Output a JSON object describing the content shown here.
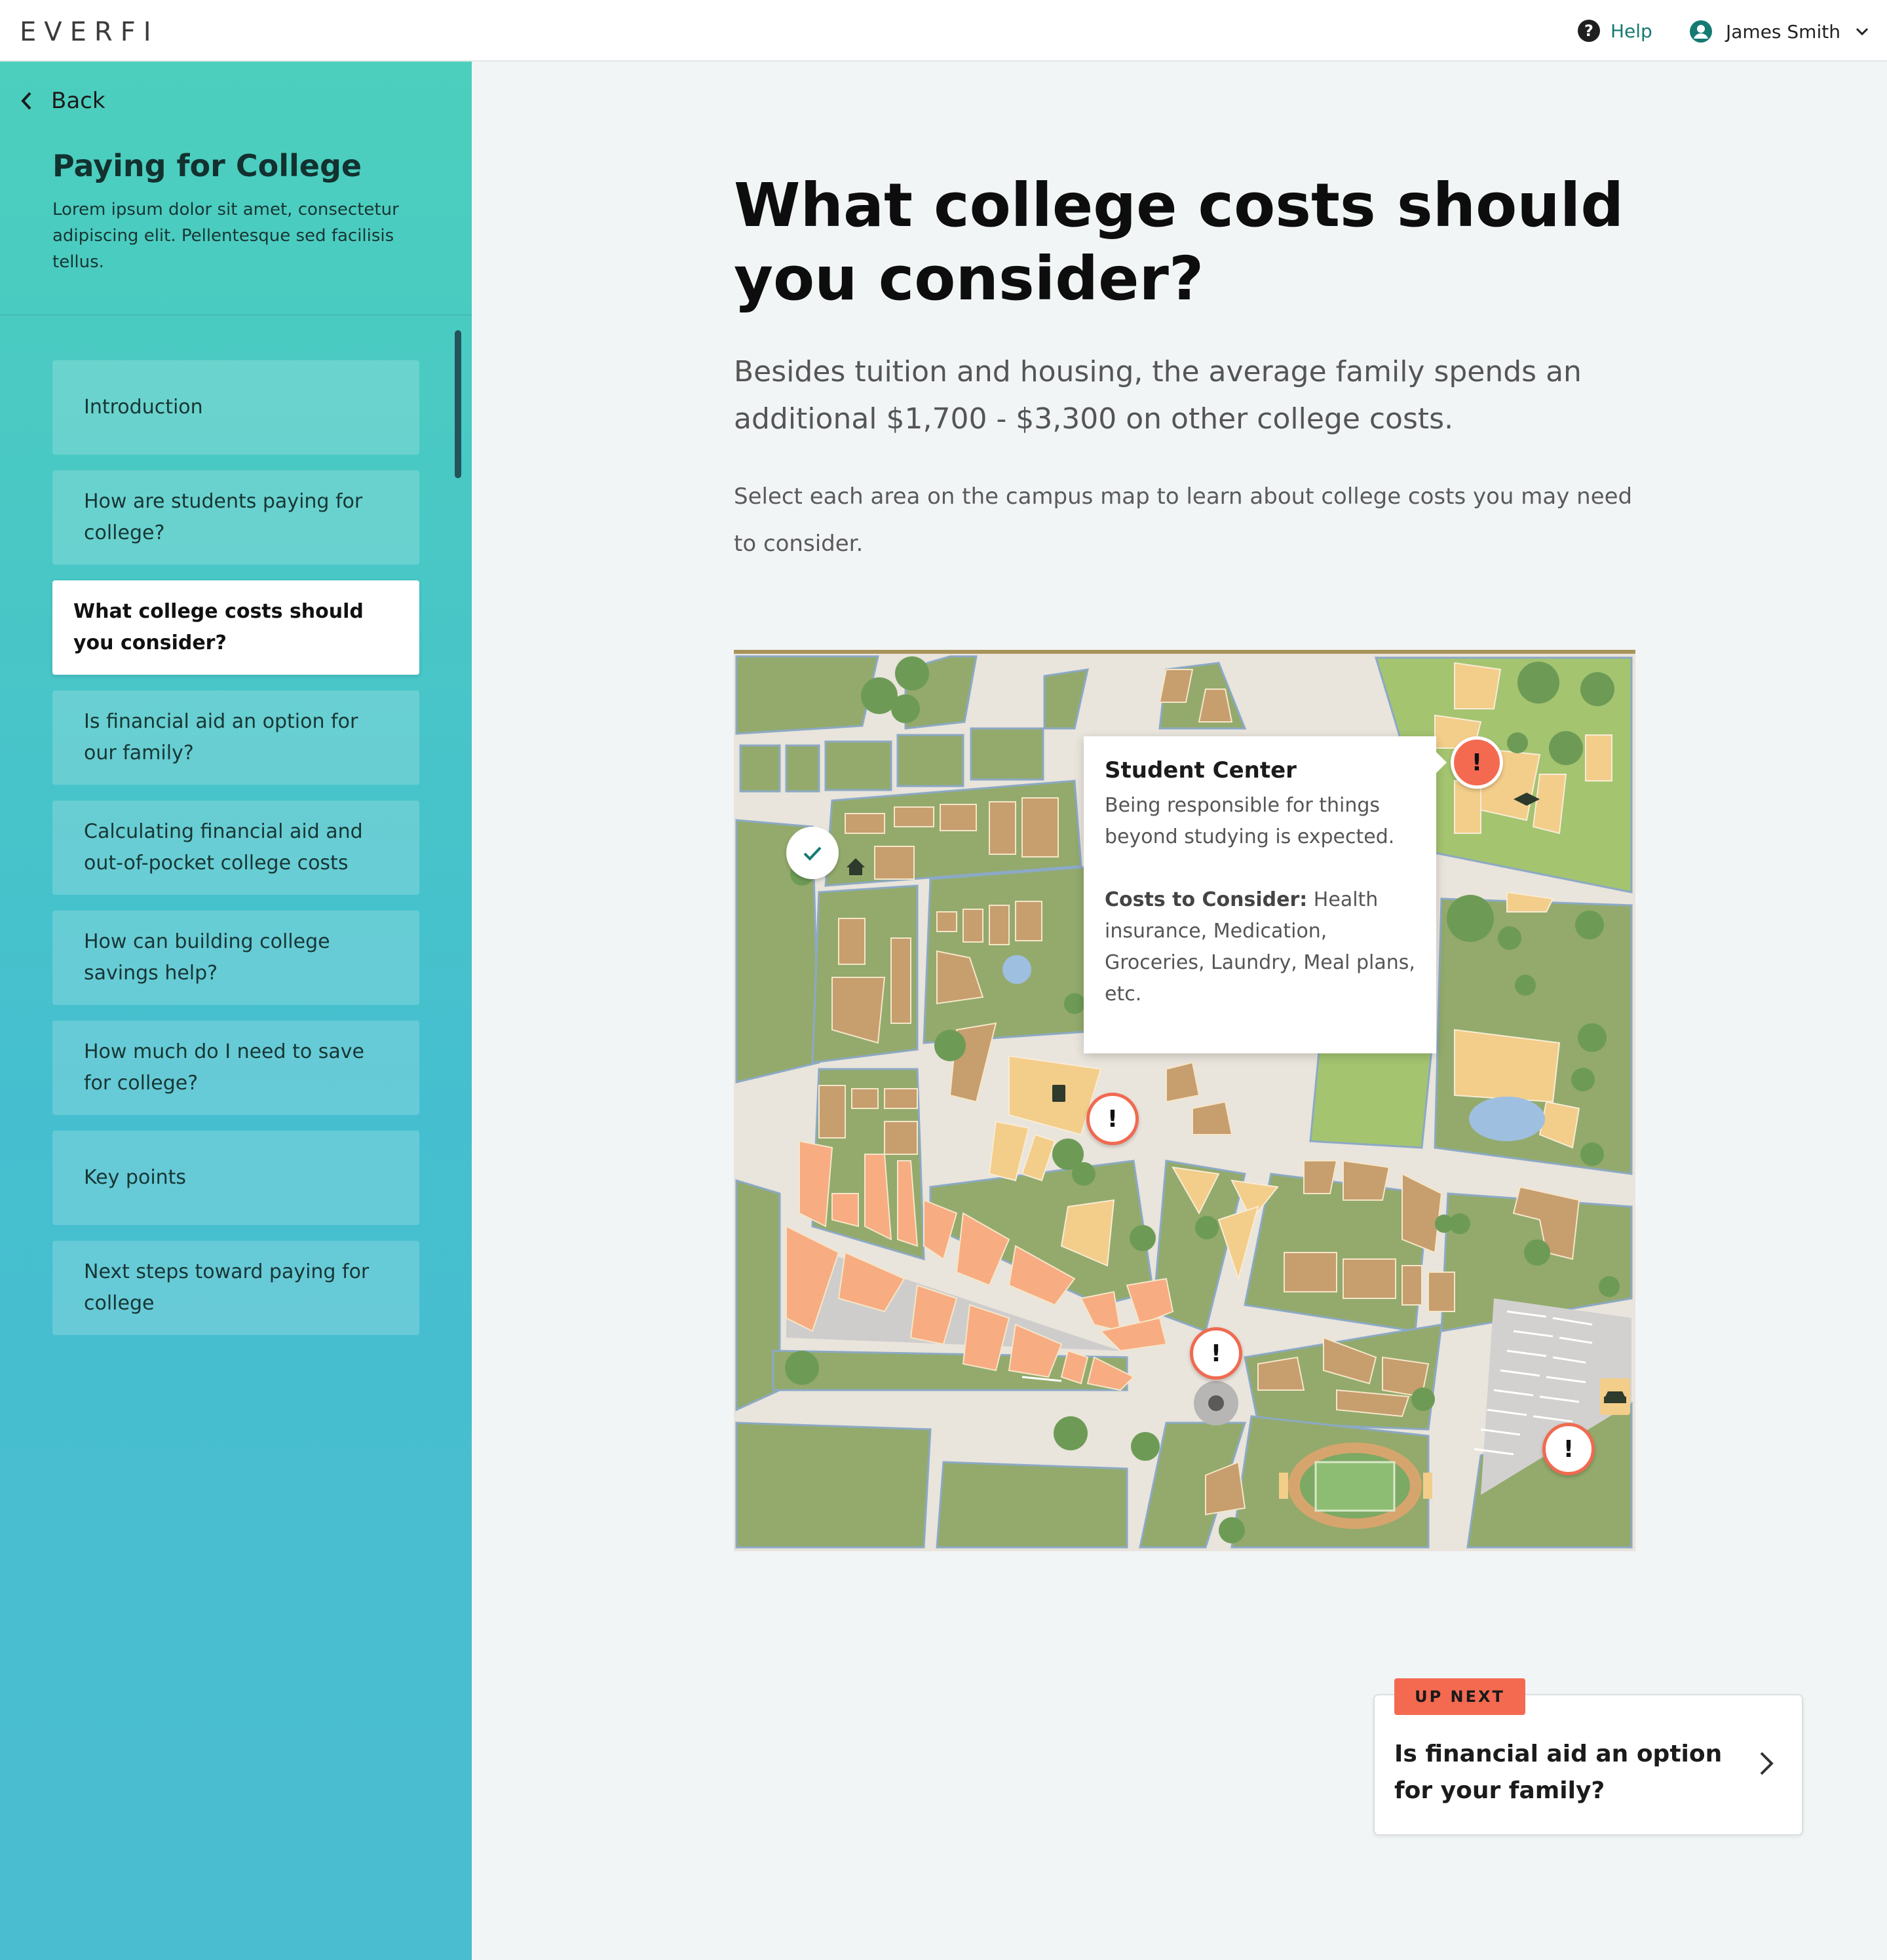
{
  "header": {
    "logo": "EVERFI",
    "help_label": "Help",
    "user_name": "James Smith"
  },
  "sidebar": {
    "back_label": "Back",
    "course_title": "Paying for College",
    "course_description": "Lorem ipsum dolor sit amet, consectetur adipiscing elit. Pellentesque sed facilisis tellus.",
    "items": [
      {
        "label": "Introduction",
        "active": false
      },
      {
        "label": "How are students paying for college?",
        "active": false
      },
      {
        "label": "What college costs should you consider?",
        "active": true
      },
      {
        "label": "Is financial aid an option for our family?",
        "active": false
      },
      {
        "label": "Calculating financial aid and out-of-pocket college costs",
        "active": false
      },
      {
        "label": "How can building college savings help?",
        "active": false
      },
      {
        "label": "How much do I need to save for college?",
        "active": false
      },
      {
        "label": "Key points",
        "active": false
      },
      {
        "label": "Next steps toward paying for college",
        "active": false
      }
    ]
  },
  "main": {
    "heading": "What college costs should you consider?",
    "subheading": "Besides tuition and housing, the average family spends an additional $1,700 - $3,300 on other college costs.",
    "instruction": "Select each area on the campus map to learn about college costs you may need to consider."
  },
  "map": {
    "tooltip": {
      "title": "Student Center",
      "body": "Being responsible for things beyond studying is expected.",
      "costs_label": "Costs to Consider:",
      "costs_text": " Health insurance, Medication, Groceries, Laundry, Meal plans, etc."
    },
    "marker_glyph": "!"
  },
  "up_next": {
    "badge": "UP NEXT",
    "title": "Is financial aid an option for your family?"
  },
  "colors": {
    "accent_teal": "#157a72",
    "alert_orange": "#f46a51",
    "sidebar_top": "#4ccfbd",
    "sidebar_bottom": "#4bbdd0"
  }
}
